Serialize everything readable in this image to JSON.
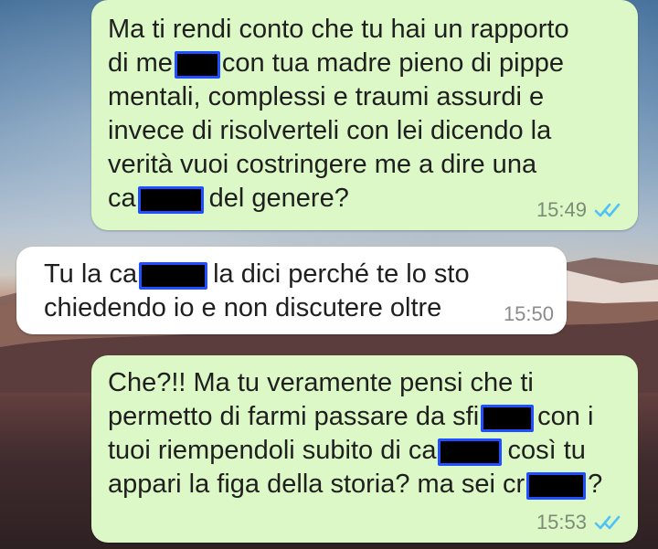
{
  "messages": [
    {
      "type": "outgoing",
      "lines": [
        "Ma ti rendi conto che tu hai un rapporto",
        "di me",
        "con tua madre pieno di pippe",
        "mentali, complessi e traumi assurdi e",
        "invece di risolverteli con lei dicendo la",
        "verità vuoi costringere me a dire una",
        "ca",
        "del genere?"
      ],
      "time": "15:49",
      "status_icon": "double-check-read-icon"
    },
    {
      "type": "incoming",
      "lines": [
        "Tu la ca",
        "la dici perché te lo sto",
        "chiedendo io e non discutere oltre"
      ],
      "time": "15:50"
    },
    {
      "type": "outgoing",
      "lines": [
        "Che?!! Ma tu veramente pensi che ti",
        "permetto di farmi passare da sfi",
        "con i",
        "tuoi riempendoli subito di ca",
        "così tu",
        "appari la figa della storia? ma sei cr",
        "?"
      ],
      "time": "15:53",
      "status_icon": "double-check-read-icon"
    }
  ],
  "colors": {
    "outgoing_bubble": "#dcf8c6",
    "incoming_bubble": "#ffffff",
    "read_ticks": "#4fc3f7",
    "redaction_fill": "#000000",
    "redaction_border": "#1f4fff"
  }
}
